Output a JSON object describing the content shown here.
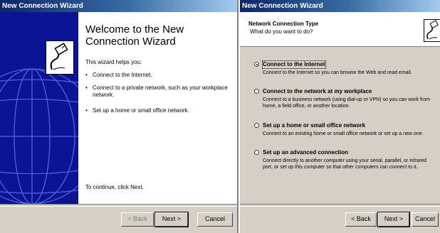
{
  "window1": {
    "title": "New Connection Wizard",
    "heading": "Welcome to the New Connection Wizard",
    "intro": "This wizard helps you:",
    "bullets": [
      "Connect to the Internet.",
      "Connect to a private network, such as your workplace network.",
      "Set up a home or small office network."
    ],
    "continue_text": "To continue, click Next.",
    "buttons": {
      "back": "< Back",
      "next": "Next >",
      "cancel": "Cancel"
    }
  },
  "window2": {
    "title": "New Connection Wizard",
    "header_title": "Network Connection Type",
    "header_subtitle": "What do you want to do?",
    "options": [
      {
        "label": "Connect to the Internet",
        "desc": "Connect to the Internet so you can browse the Web and read email.",
        "checked": true
      },
      {
        "label": "Connect to the network at my workplace",
        "desc": "Connect to a business network (using dial-up or VPN) so you can work from home, a field office, or another location.",
        "checked": false
      },
      {
        "label": "Set up a home or small office network",
        "desc": "Connect to an existing home or small office network or set up a new one.",
        "checked": false
      },
      {
        "label": "Set up an advanced connection",
        "desc": "Connect directly to another computer using your serial, parallel, or infrared port, or set up this computer so that other computers can connect to it.",
        "checked": false
      }
    ],
    "buttons": {
      "back": "< Back",
      "next": "Next >",
      "cancel": "Cancel"
    }
  },
  "icons": {
    "wizard": "network-cable-plug-icon",
    "header": "network-cable-plug-icon",
    "background": "globe-grid-icon"
  },
  "colors": {
    "title_bar": "#0a246a",
    "side_panel": "#0b1494",
    "dialog_face": "#d4d0c8"
  }
}
